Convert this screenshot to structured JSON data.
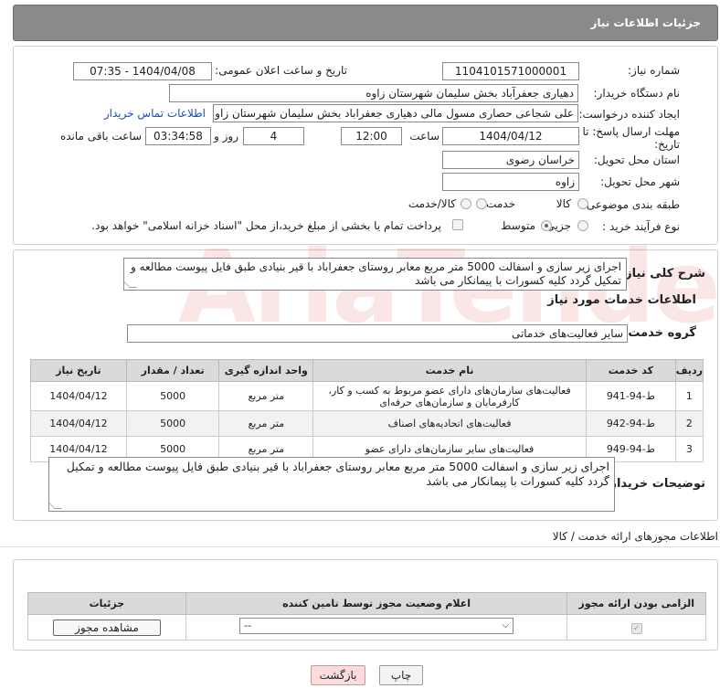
{
  "header": {
    "title": "جزئیات اطلاعات نیاز"
  },
  "form": {
    "need_number_label": "شماره نیاز:",
    "need_number": "1104101571000001",
    "announce_label": "تاریخ و ساعت اعلان عمومی:",
    "announce_value": "1404/04/08 - 07:35",
    "buyer_org_label": "نام دستگاه خریدار:",
    "buyer_org": "دهیاری جعفرآباد بخش سلیمان شهرستان زاوه",
    "creator_label": "ایجاد کننده درخواست:",
    "creator": "علی شجاعی حصاری مسول مالی دهیاری جعفراباد بخش سلیمان شهرستان زاوه",
    "contact_link": "اطلاعات تماس خریدار",
    "deadline_label": "مهلت ارسال پاسخ: تا تاریخ:",
    "deadline_date": "1404/04/12",
    "time_label": "ساعت",
    "deadline_time": "12:00",
    "days_count": "4",
    "days_label": "روز و",
    "remaining_time": "03:34:58",
    "remaining_label": "ساعت باقی مانده",
    "province_label": "استان محل تحویل:",
    "province": "خراسان رضوی",
    "city_label": "شهر محل تحویل:",
    "city": "زاوه",
    "category_label": "طبقه بندی موضوعی:",
    "category_options": [
      "کالا",
      "خدمت",
      "کالا/خدمت"
    ],
    "process_label": "نوع فرآیند خرید :",
    "process_options": [
      "جزیی",
      "متوسط"
    ],
    "payment_note": "پرداخت تمام یا بخشی از مبلغ خرید،از محل \"اسناد خزانه اسلامی\" خواهد بود."
  },
  "summary": {
    "label": "شرح کلی نیاز:",
    "text": "اجرای زیر سازی و اسفالت 5000 متر مربع معابر روستای جعفراباد با قیر بنیادی طبق فایل پیوست مطالعه و تمکیل گردد کلیه کسورات با پیمانکار می باشد"
  },
  "services": {
    "title": "اطلاعات خدمات مورد نیاز",
    "group_label": "گروه خدمت:",
    "group_value": "سایر فعالیت‌های خدماتی",
    "columns": [
      "ردیف",
      "کد خدمت",
      "نام خدمت",
      "واحد اندازه گیری",
      "تعداد / مقدار",
      "تاریخ نیاز"
    ],
    "rows": [
      {
        "n": "1",
        "code": "ط-94-941",
        "name": "فعالیت‌های سازمان‌های دارای عضو مربوط به کسب و کار، کارفرمایان و سازمان‌های حرفه‌ای",
        "unit": "متر مربع",
        "qty": "5000",
        "date": "1404/04/12"
      },
      {
        "n": "2",
        "code": "ط-94-942",
        "name": "فعالیت‌های اتحادیه‌های اصناف",
        "unit": "متر مربع",
        "qty": "5000",
        "date": "1404/04/12"
      },
      {
        "n": "3",
        "code": "ط-94-949",
        "name": "فعالیت‌های سایر سازمان‌های دارای عضو",
        "unit": "متر مربع",
        "qty": "5000",
        "date": "1404/04/12"
      }
    ]
  },
  "buyer_notes": {
    "label": "توضیحات خریدار:",
    "text": "اجرای زیر سازی و اسفالت 5000 متر مربع معابر روستای جعفراباد با قیر بنیادی طبق فایل پیوست مطالعه و تمکیل گردد کلیه کسورات با پیمانکار می باشد"
  },
  "permits": {
    "title": "اطلاعات مجوزهای ارائه خدمت / کالا",
    "columns": [
      "الزامی بودن ارائه مجوز",
      "اعلام وضعیت مجوز توسط تامین کننده",
      "جزئیات"
    ],
    "select_value": "--",
    "view_button": "مشاهده مجوز"
  },
  "buttons": {
    "print": "چاپ",
    "back": "بازگشت"
  },
  "watermark": "AriaTender.neT"
}
